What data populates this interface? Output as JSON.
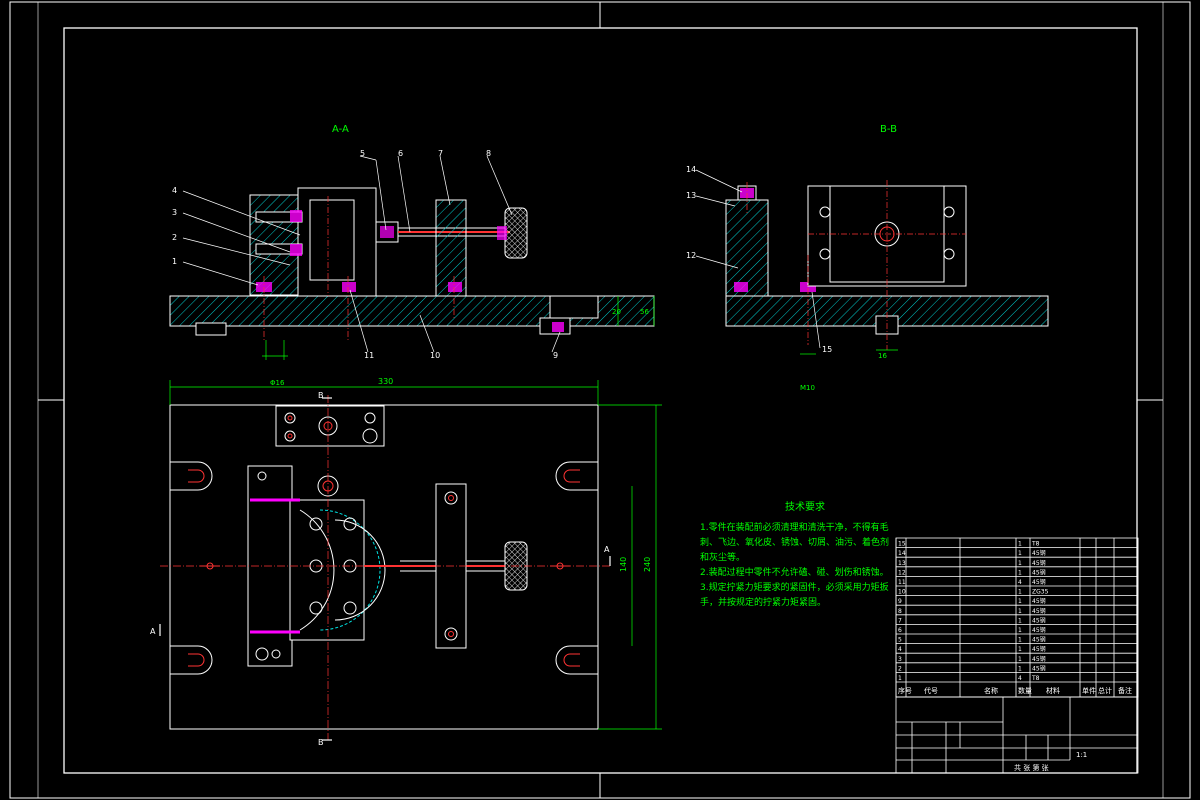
{
  "views": {
    "section_a": "A-A",
    "section_b": "B-B",
    "arrow_a": "A",
    "arrow_b": "B"
  },
  "balloons": {
    "a_view": [
      "1",
      "2",
      "3",
      "4",
      "5",
      "6",
      "7",
      "8",
      "9",
      "10",
      "11"
    ],
    "b_view": [
      "12",
      "13",
      "14",
      "15"
    ]
  },
  "dimensions": {
    "width": "330",
    "height": "240",
    "inner_height": "140",
    "h1": "56",
    "h2": "20",
    "h3": "16",
    "slot": "Φ16",
    "bolt": "M10"
  },
  "tech_requirements": {
    "title": "技术要求",
    "items": [
      "1.零件在装配前必须清理和清洗干净，不得有毛刺、飞边、氧化皮、锈蚀、切屑、油污、着色剂和灰尘等。",
      "2.装配过程中零件不允许磕、碰、划伤和锈蚀。",
      "3.规定拧紧力矩要求的紧固件，必须采用力矩扳手，并按规定的拧紧力矩紧固。"
    ]
  },
  "bom_header": [
    "序号",
    "代号",
    "名称",
    "数量",
    "材料",
    "单件",
    "总计",
    "备注"
  ],
  "bom_rows": [
    [
      "15",
      "",
      "",
      "1",
      "T8"
    ],
    [
      "14",
      "",
      "",
      "1",
      "45钢"
    ],
    [
      "13",
      "",
      "",
      "1",
      "45钢"
    ],
    [
      "12",
      "",
      "",
      "1",
      "45钢"
    ],
    [
      "11",
      "",
      "",
      "4",
      "45钢"
    ],
    [
      "10",
      "",
      "",
      "1",
      "ZG35"
    ],
    [
      "9",
      "",
      "",
      "1",
      "45钢"
    ],
    [
      "8",
      "",
      "",
      "1",
      "45钢"
    ],
    [
      "7",
      "",
      "",
      "1",
      "45钢"
    ],
    [
      "6",
      "",
      "",
      "1",
      "45钢"
    ],
    [
      "5",
      "",
      "",
      "1",
      "45钢"
    ],
    [
      "4",
      "",
      "",
      "1",
      "45钢"
    ],
    [
      "3",
      "",
      "",
      "1",
      "45钢"
    ],
    [
      "2",
      "",
      "",
      "1",
      "45钢"
    ],
    [
      "1",
      "",
      "",
      "4",
      "T8"
    ]
  ],
  "title_block": {
    "scale": "1:1",
    "sheet": "共 张 第 张"
  }
}
